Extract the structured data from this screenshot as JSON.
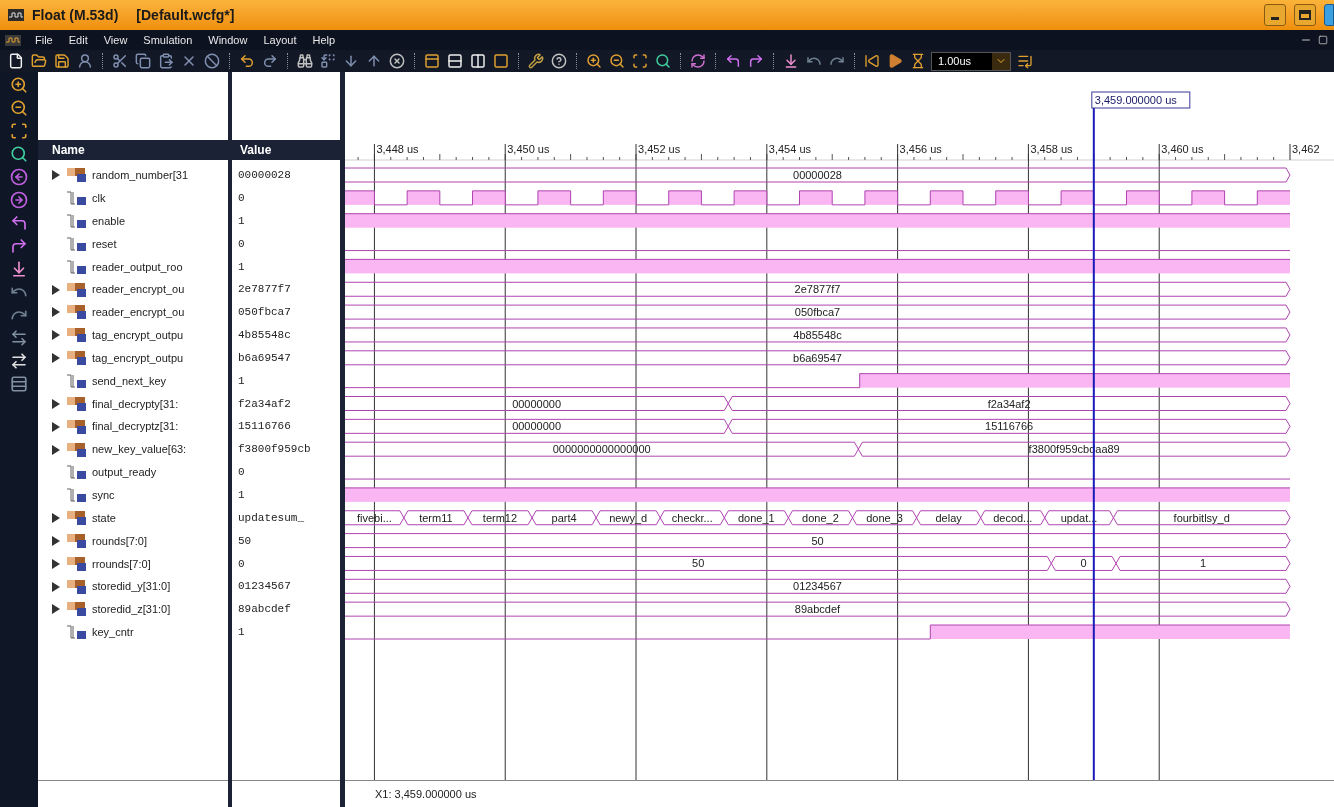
{
  "window": {
    "title": "Float (M.53d)",
    "document": "[Default.wcfg*]"
  },
  "menu": [
    "File",
    "Edit",
    "View",
    "Smulation",
    "Window",
    "Layout",
    "Help"
  ],
  "toolbar": {
    "time_field": "1.00us"
  },
  "columns": {
    "name": "Name",
    "value": "Value"
  },
  "signals": [
    {
      "name": "random_number[31",
      "value": "00000028",
      "kind": "bus",
      "segments": [
        "00000028"
      ]
    },
    {
      "name": "clk",
      "value": "0",
      "kind": "bit"
    },
    {
      "name": "enable",
      "value": "1",
      "kind": "bit"
    },
    {
      "name": "reset",
      "value": "0",
      "kind": "bit"
    },
    {
      "name": "reader_output_roo",
      "value": "1",
      "kind": "bit"
    },
    {
      "name": "reader_encrypt_ou",
      "value": "2e7877f7",
      "kind": "bus",
      "segments": [
        "2e7877f7"
      ]
    },
    {
      "name": "reader_encrypt_ou",
      "value": "050fbca7",
      "kind": "bus",
      "segments": [
        "050fbca7"
      ]
    },
    {
      "name": "tag_encrypt_outpu",
      "value": "4b85548c",
      "kind": "bus",
      "segments": [
        "4b85548c"
      ]
    },
    {
      "name": "tag_encrypt_outpu",
      "value": "b6a69547",
      "kind": "bus",
      "segments": [
        "b6a69547"
      ]
    },
    {
      "name": "send_next_key",
      "value": "1",
      "kind": "bit"
    },
    {
      "name": "final_decrypty[31:",
      "value": "f2a34af2",
      "kind": "bus",
      "segments": [
        "00000000",
        "f2a34af2"
      ]
    },
    {
      "name": "final_decryptz[31:",
      "value": "15116766",
      "kind": "bus",
      "segments": [
        "00000000",
        "15116766"
      ]
    },
    {
      "name": "new_key_value[63:",
      "value": "f3800f959cb",
      "kind": "bus",
      "segments": [
        "0000000000000000",
        "f3800f959cbdaa89"
      ]
    },
    {
      "name": "output_ready",
      "value": "0",
      "kind": "bit"
    },
    {
      "name": "sync",
      "value": "1",
      "kind": "bit"
    },
    {
      "name": "state",
      "value": "updatesum_",
      "kind": "bus",
      "segments": [
        "fivebi...",
        "term11",
        "term12",
        "part4",
        "newy_d",
        "checkr...",
        "done_1",
        "done_2",
        "done_3",
        "delay",
        "decod...",
        "updat...",
        "fourbitlsy_d"
      ]
    },
    {
      "name": "rounds[7:0]",
      "value": "50",
      "kind": "bus",
      "segments": [
        "50"
      ]
    },
    {
      "name": "rrounds[7:0]",
      "value": "0",
      "kind": "bus",
      "segments": [
        "50",
        "0",
        "1"
      ]
    },
    {
      "name": "storedid_y[31:0]",
      "value": "01234567",
      "kind": "bus",
      "segments": [
        "01234567"
      ]
    },
    {
      "name": "storedid_z[31:0]",
      "value": "89abcdef",
      "kind": "bus",
      "segments": [
        "89abcdef"
      ]
    },
    {
      "name": "key_cntr",
      "value": "1",
      "kind": "bit"
    }
  ],
  "waveform": {
    "ruler": [
      "3,448 us",
      "3,450 us",
      "3,452 us",
      "3,454 us",
      "3,456 us",
      "3,458 us",
      "3,460 us",
      "3,462"
    ],
    "cursor_label": "3,459.000000 us",
    "cursor_readout": "X1: 3,459.000000 us"
  }
}
